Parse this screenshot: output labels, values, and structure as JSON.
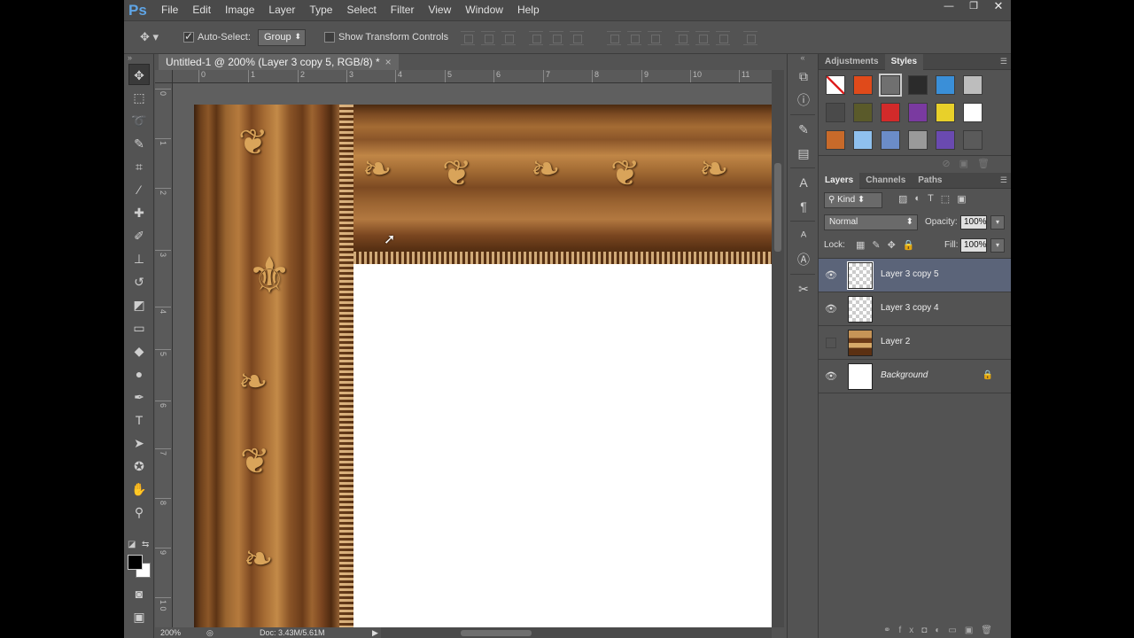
{
  "app": {
    "logo": "Ps",
    "menu": [
      "File",
      "Edit",
      "Image",
      "Layer",
      "Type",
      "Select",
      "Filter",
      "View",
      "Window",
      "Help"
    ],
    "window_controls": {
      "minimize": "—",
      "restore": "❐",
      "close": "✕"
    }
  },
  "options_bar": {
    "auto_select_label": "Auto-Select:",
    "auto_select_checked": true,
    "auto_select_target": "Group",
    "show_transform_label": "Show Transform Controls",
    "show_transform_checked": false
  },
  "document": {
    "tab_title": "Untitled-1 @ 200% (Layer 3 copy 5, RGB/8) *",
    "close_glyph": "×",
    "ruler_top_ticks": [
      "0",
      "1",
      "2",
      "3",
      "4",
      "5",
      "6",
      "7",
      "8",
      "9",
      "10",
      "11"
    ],
    "ruler_left_ticks": [
      "0",
      "1",
      "2",
      "3",
      "4",
      "5",
      "6",
      "7",
      "8",
      "9",
      "1 0"
    ],
    "zoom": "200%",
    "doc_size": "Doc: 3.43M/5.61M"
  },
  "panels": {
    "top_tabs": [
      "Adjustments",
      "Styles"
    ],
    "active_top_tab": "Styles",
    "style_swatches": [
      "#ffffff",
      "#e04a1a",
      "#707070",
      "#2b2b2b",
      "#3a8fd8",
      "#bdbdbd",
      "#4a4a4a",
      "#5a5a2a",
      "#d22a2a",
      "#7a3aa0",
      "#e8d02a",
      "#ffffff",
      "#c86a2a",
      "#8fc0ee",
      "#6b8cc8",
      "#9a9a9a",
      "#6a4ab0",
      "#5a5a5a"
    ],
    "layers_tabs": [
      "Layers",
      "Channels",
      "Paths"
    ],
    "active_layers_tab": "Layers",
    "kind_label": "Kind",
    "blend_mode": "Normal",
    "opacity_label": "Opacity:",
    "opacity_value": "100%",
    "lock_label": "Lock:",
    "fill_label": "Fill:",
    "fill_value": "100%",
    "layers": [
      {
        "name": "Layer 3 copy 5",
        "visible": true,
        "selected": true
      },
      {
        "name": "Layer 3 copy 4",
        "visible": true,
        "selected": false
      },
      {
        "name": "Layer 2",
        "visible": false,
        "selected": false
      },
      {
        "name": "Background",
        "visible": true,
        "selected": false,
        "locked": true
      }
    ]
  },
  "colors": {
    "app_bg": "#535353",
    "selected_layer": "#5b6479",
    "ps_blue": "#5fa5e6"
  }
}
